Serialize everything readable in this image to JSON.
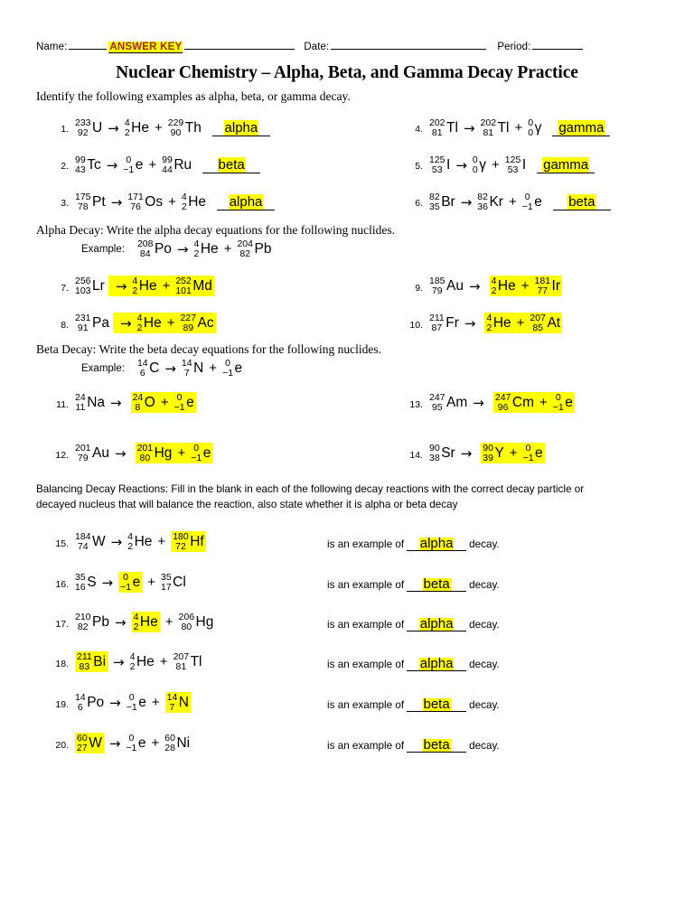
{
  "header": {
    "name_label": "Name:",
    "answer_key": "ANSWER KEY",
    "date_label": "Date:",
    "period_label": "Period:",
    "title": "Nuclear Chemistry – Alpha, Beta, and Gamma Decay Practice"
  },
  "section1": {
    "instruction": "Identify the following examples as alpha, beta, or gamma decay.",
    "problems": [
      {
        "num": "1.",
        "terms": [
          {
            "kind": "nuclide",
            "top": "233",
            "bot": "92",
            "sym": "U"
          },
          {
            "kind": "arrow",
            "text": "→"
          },
          {
            "kind": "nuclide",
            "top": "4",
            "bot": "2",
            "sym": "He"
          },
          {
            "kind": "op",
            "text": "+"
          },
          {
            "kind": "nuclide",
            "top": "229",
            "bot": "90",
            "sym": "Th"
          }
        ],
        "answer": "alpha"
      },
      {
        "num": "2.",
        "terms": [
          {
            "kind": "nuclide",
            "top": "99",
            "bot": "43",
            "sym": "Tc"
          },
          {
            "kind": "arrow",
            "text": "→"
          },
          {
            "kind": "nuclide",
            "top": "0",
            "bot": "−1",
            "sym": "e"
          },
          {
            "kind": "op",
            "text": "+"
          },
          {
            "kind": "nuclide",
            "top": "99",
            "bot": "44",
            "sym": "Ru"
          }
        ],
        "answer": "beta"
      },
      {
        "num": "3.",
        "terms": [
          {
            "kind": "nuclide",
            "top": "175",
            "bot": "78",
            "sym": "Pt"
          },
          {
            "kind": "arrow",
            "text": "→"
          },
          {
            "kind": "nuclide",
            "top": "171",
            "bot": "76",
            "sym": "Os"
          },
          {
            "kind": "op",
            "text": "+"
          },
          {
            "kind": "nuclide",
            "top": "4",
            "bot": "2",
            "sym": "He"
          }
        ],
        "answer": "alpha"
      },
      {
        "num": "4.",
        "terms": [
          {
            "kind": "nuclide",
            "top": "202",
            "bot": "81",
            "sym": "Tl"
          },
          {
            "kind": "arrow",
            "text": "→"
          },
          {
            "kind": "nuclide",
            "top": "202",
            "bot": "81",
            "sym": "Tl"
          },
          {
            "kind": "op",
            "text": "+"
          },
          {
            "kind": "nuclide",
            "top": "0",
            "bot": "0",
            "sym": "γ"
          }
        ],
        "answer": "gamma"
      },
      {
        "num": "5.",
        "terms": [
          {
            "kind": "nuclide",
            "top": "125",
            "bot": "53",
            "sym": "I"
          },
          {
            "kind": "arrow",
            "text": "→"
          },
          {
            "kind": "nuclide",
            "top": "0",
            "bot": "0",
            "sym": "γ"
          },
          {
            "kind": "op",
            "text": "+"
          },
          {
            "kind": "nuclide",
            "top": "125",
            "bot": "53",
            "sym": "I"
          }
        ],
        "answer": "gamma"
      },
      {
        "num": "6.",
        "terms": [
          {
            "kind": "nuclide",
            "top": "82",
            "bot": "35",
            "sym": "Br"
          },
          {
            "kind": "arrow",
            "text": "→"
          },
          {
            "kind": "nuclide",
            "top": "82",
            "bot": "36",
            "sym": "Kr"
          },
          {
            "kind": "op",
            "text": "+"
          },
          {
            "kind": "nuclide",
            "top": "0",
            "bot": "−1",
            "sym": "e"
          }
        ],
        "answer": "beta"
      }
    ]
  },
  "section2": {
    "instruction": "Alpha Decay: Write the alpha decay equations for the following nuclides.",
    "example_label": "Example:",
    "example": [
      {
        "kind": "nuclide",
        "top": "208",
        "bot": "84",
        "sym": "Po"
      },
      {
        "kind": "arrow",
        "text": "→"
      },
      {
        "kind": "nuclide",
        "top": "4",
        "bot": "2",
        "sym": "He"
      },
      {
        "kind": "op",
        "text": "+"
      },
      {
        "kind": "nuclide",
        "top": "204",
        "bot": "82",
        "sym": "Pb"
      }
    ],
    "problems": [
      {
        "num": "7.",
        "given": [
          {
            "kind": "nuclide",
            "top": "256",
            "bot": "103",
            "sym": "Lr"
          }
        ],
        "answer": [
          {
            "kind": "arrow",
            "text": "→"
          },
          {
            "kind": "nuclide",
            "top": "4",
            "bot": "2",
            "sym": "He"
          },
          {
            "kind": "op",
            "text": "+"
          },
          {
            "kind": "nuclide",
            "top": "252",
            "bot": "101",
            "sym": "Md"
          }
        ]
      },
      {
        "num": "8.",
        "given": [
          {
            "kind": "nuclide",
            "top": "231",
            "bot": "91",
            "sym": "Pa"
          }
        ],
        "answer": [
          {
            "kind": "arrow",
            "text": "→"
          },
          {
            "kind": "nuclide",
            "top": "4",
            "bot": "2",
            "sym": "He"
          },
          {
            "kind": "op",
            "text": "+"
          },
          {
            "kind": "nuclide",
            "top": "227",
            "bot": "89",
            "sym": "Ac"
          }
        ]
      },
      {
        "num": "9.",
        "given": [
          {
            "kind": "nuclide",
            "top": "185",
            "bot": "79",
            "sym": "Au"
          },
          {
            "kind": "arrow",
            "text": "→"
          }
        ],
        "answer": [
          {
            "kind": "nuclide",
            "top": "4",
            "bot": "2",
            "sym": "He"
          },
          {
            "kind": "op",
            "text": "+"
          },
          {
            "kind": "nuclide",
            "top": "181",
            "bot": "77",
            "sym": "Ir"
          }
        ]
      },
      {
        "num": "10.",
        "given": [
          {
            "kind": "nuclide",
            "top": "211",
            "bot": "87",
            "sym": "Fr"
          },
          {
            "kind": "arrow",
            "text": "→"
          }
        ],
        "answer": [
          {
            "kind": "nuclide",
            "top": "4",
            "bot": "2",
            "sym": "He"
          },
          {
            "kind": "op",
            "text": "+"
          },
          {
            "kind": "nuclide",
            "top": "207",
            "bot": "85",
            "sym": "At"
          }
        ]
      }
    ]
  },
  "section3": {
    "instruction": "Beta Decay: Write the beta decay equations for the following nuclides.",
    "example_label": "Example:",
    "example": [
      {
        "kind": "nuclide",
        "top": "14",
        "bot": "6",
        "sym": "C"
      },
      {
        "kind": "arrow",
        "text": "→"
      },
      {
        "kind": "nuclide",
        "top": "14",
        "bot": "7",
        "sym": "N"
      },
      {
        "kind": "op",
        "text": "+"
      },
      {
        "kind": "nuclide",
        "top": "0",
        "bot": "−1",
        "sym": "e"
      }
    ],
    "problems": [
      {
        "num": "11.",
        "given": [
          {
            "kind": "nuclide",
            "top": "24",
            "bot": "11",
            "sym": "Na"
          },
          {
            "kind": "arrow",
            "text": "→"
          }
        ],
        "answer": [
          {
            "kind": "nuclide",
            "top": "24",
            "bot": "8",
            "sym": "O"
          },
          {
            "kind": "op",
            "text": "+"
          },
          {
            "kind": "nuclide",
            "top": "0",
            "bot": "−1",
            "sym": "e"
          }
        ]
      },
      {
        "num": "12.",
        "given": [
          {
            "kind": "nuclide",
            "top": "201",
            "bot": "79",
            "sym": "Au"
          },
          {
            "kind": "arrow",
            "text": "→"
          }
        ],
        "answer": [
          {
            "kind": "nuclide",
            "top": "201",
            "bot": "80",
            "sym": "Hg"
          },
          {
            "kind": "op",
            "text": "+"
          },
          {
            "kind": "nuclide",
            "top": "0",
            "bot": "−1",
            "sym": "e"
          }
        ]
      },
      {
        "num": "13.",
        "given": [
          {
            "kind": "nuclide",
            "top": "247",
            "bot": "95",
            "sym": "Am"
          },
          {
            "kind": "arrow",
            "text": "→"
          }
        ],
        "answer": [
          {
            "kind": "nuclide",
            "top": "247",
            "bot": "96",
            "sym": "Cm"
          },
          {
            "kind": "op",
            "text": "+"
          },
          {
            "kind": "nuclide",
            "top": "0",
            "bot": "−1",
            "sym": "e"
          }
        ]
      },
      {
        "num": "14.",
        "given": [
          {
            "kind": "nuclide",
            "top": "90",
            "bot": "38",
            "sym": "Sr"
          },
          {
            "kind": "arrow",
            "text": "→"
          }
        ],
        "answer": [
          {
            "kind": "nuclide",
            "top": "90",
            "bot": "39",
            "sym": "Y"
          },
          {
            "kind": "op",
            "text": "+"
          },
          {
            "kind": "nuclide",
            "top": "0",
            "bot": "−1",
            "sym": "e"
          }
        ]
      }
    ]
  },
  "section4": {
    "instruction_line1": "Balancing Decay Reactions: Fill in the blank in each of the following decay reactions with the correct decay particle or",
    "instruction_line2": "decayed nucleus that will balance the reaction, also state whether it is alpha or beta decay",
    "lead_text": "is an example of",
    "trail_text": "decay.",
    "problems": [
      {
        "num": "15.",
        "terms": [
          {
            "kind": "nuclide",
            "top": "184",
            "bot": "74",
            "sym": "W"
          },
          {
            "kind": "arrow",
            "text": "→"
          },
          {
            "kind": "nuclide",
            "top": "4",
            "bot": "2",
            "sym": "He"
          },
          {
            "kind": "op",
            "text": "+"
          },
          {
            "kind": "nuclide",
            "top": "180",
            "bot": "72",
            "sym": "Hf",
            "hl": true
          }
        ],
        "answer": "alpha"
      },
      {
        "num": "16.",
        "terms": [
          {
            "kind": "nuclide",
            "top": "35",
            "bot": "16",
            "sym": "S"
          },
          {
            "kind": "arrow",
            "text": "→"
          },
          {
            "kind": "nuclide",
            "top": "0",
            "bot": "−1",
            "sym": "e",
            "hl": true
          },
          {
            "kind": "op",
            "text": "+"
          },
          {
            "kind": "nuclide",
            "top": "35",
            "bot": "17",
            "sym": "Cl"
          }
        ],
        "answer": "beta"
      },
      {
        "num": "17.",
        "terms": [
          {
            "kind": "nuclide",
            "top": "210",
            "bot": "82",
            "sym": "Pb"
          },
          {
            "kind": "arrow",
            "text": "→"
          },
          {
            "kind": "nuclide",
            "top": "4",
            "bot": "2",
            "sym": "He",
            "hl": true
          },
          {
            "kind": "op",
            "text": "+"
          },
          {
            "kind": "nuclide",
            "top": "206",
            "bot": "80",
            "sym": "Hg"
          }
        ],
        "answer": "alpha"
      },
      {
        "num": "18.",
        "terms": [
          {
            "kind": "nuclide",
            "top": "211",
            "bot": "83",
            "sym": "Bi",
            "hl": true
          },
          {
            "kind": "arrow",
            "text": "→"
          },
          {
            "kind": "nuclide",
            "top": "4",
            "bot": "2",
            "sym": "He"
          },
          {
            "kind": "op",
            "text": "+"
          },
          {
            "kind": "nuclide",
            "top": "207",
            "bot": "81",
            "sym": "Tl"
          }
        ],
        "answer": "alpha"
      },
      {
        "num": "19.",
        "terms": [
          {
            "kind": "nuclide",
            "top": "14",
            "bot": "6",
            "sym": "Po"
          },
          {
            "kind": "arrow",
            "text": "→"
          },
          {
            "kind": "nuclide",
            "top": "0",
            "bot": "−1",
            "sym": "e"
          },
          {
            "kind": "op",
            "text": "+"
          },
          {
            "kind": "nuclide",
            "top": "14",
            "bot": "7",
            "sym": "N",
            "hl": true
          }
        ],
        "answer": "beta"
      },
      {
        "num": "20.",
        "terms": [
          {
            "kind": "nuclide",
            "top": "60",
            "bot": "27",
            "sym": "W",
            "hl": true
          },
          {
            "kind": "arrow",
            "text": "→"
          },
          {
            "kind": "nuclide",
            "top": "0",
            "bot": "−1",
            "sym": "e"
          },
          {
            "kind": "op",
            "text": "+"
          },
          {
            "kind": "nuclide",
            "top": "60",
            "bot": "28",
            "sym": "Ni"
          }
        ],
        "answer": "beta"
      }
    ]
  },
  "colors": {
    "highlight": "#ffff00",
    "answer_key_text": "#9e2a1e",
    "ink": "#000000"
  }
}
